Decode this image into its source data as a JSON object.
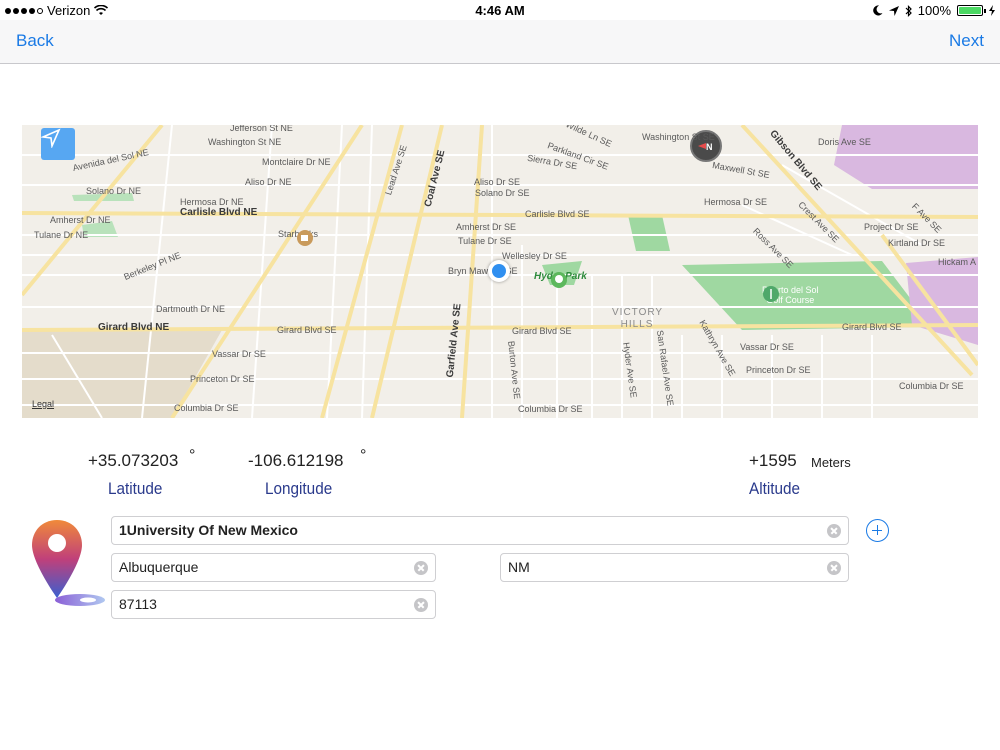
{
  "status_bar": {
    "carrier": "Verizon",
    "time": "4:46 AM",
    "battery": "100%",
    "signal_bars": 4,
    "battery_level": 1.0
  },
  "nav": {
    "back_label": "Back",
    "next_label": "Next"
  },
  "map": {
    "legal": "Legal",
    "streets": {
      "jefferson": "Jefferson St NE",
      "washington_ne": "Washington St NE",
      "avenida": "Avenida del Sol NE",
      "montclaire": "Montclaire Dr NE",
      "aliso_ne": "Aliso Dr NE",
      "solano_ne": "Solano Dr NE",
      "hermosa_ne": "Hermosa Dr NE",
      "carlisle_ne": "Carlisle Blvd NE",
      "amherst_ne": "Amherst Dr NE",
      "tulane_ne": "Tulane Dr NE",
      "berkeley": "Berkeley Pl NE",
      "dartmouth": "Dartmouth Dr NE",
      "girard_ne": "Girard Blvd NE",
      "girard_se_1": "Girard Blvd SE",
      "girard_se_2": "Girard Blvd SE",
      "girard_se_3": "Girard Blvd SE",
      "vassar_se_1": "Vassar Dr SE",
      "vassar_se_2": "Vassar Dr SE",
      "princeton_se_1": "Princeton Dr SE",
      "princeton_se_2": "Princeton Dr SE",
      "columbia_se_1": "Columbia Dr SE",
      "columbia_se_2": "Columbia Dr SE",
      "columbia_se_3": "Columbia Dr SE",
      "lead": "Lead Ave SE",
      "coal": "Coal Ave SE",
      "aliso_se": "Aliso Dr SE",
      "solano_se": "Solano Dr SE",
      "sierra": "Sierra Dr SE",
      "parkland": "Parkland Cir SE",
      "wilde": "Wilde Ln SE",
      "carlisle_se": "Carlisle Blvd SE",
      "amherst_se": "Amherst Dr SE",
      "tulane_se": "Tulane Dr SE",
      "wellesley": "Wellesley Dr SE",
      "bryn_mawr": "Bryn Mawr Dr SE",
      "garfield": "Garfield Ave SE",
      "burton": "Burton Ave SE",
      "hyder_ave": "Hyder Ave SE",
      "san_rafael": "San Rafael Ave SE",
      "kathryn": "Kathryn Ave SE",
      "washington_se": "Washington St SE",
      "maxwell": "Maxwell St SE",
      "gibson": "Gibson Blvd SE",
      "hermosa_se": "Hermosa Dr SE",
      "crest": "Crest Ave SE",
      "ross": "Ross Ave SE",
      "doris": "Doris Ave SE",
      "project": "Project Dr SE",
      "kirtland": "Kirtland Dr SE",
      "f_ave": "F Ave SE",
      "hickam": "Hickam A"
    },
    "pois": {
      "starbucks": "Starbucks",
      "hyder_park": "Hyder Park",
      "victory_hills": "VICTORY HILLS",
      "golf_course_line1": "Puerto del Sol",
      "golf_course_line2": "Golf Course"
    }
  },
  "coordinates": {
    "latitude_value": "+35.073203",
    "latitude_unit": "°",
    "latitude_label": "Latitude",
    "longitude_value": "-106.612198",
    "longitude_unit": "°",
    "longitude_label": "Longitude",
    "altitude_value": "+1595",
    "altitude_unit": "Meters",
    "altitude_label": "Altitude"
  },
  "address": {
    "street": "1University Of New Mexico",
    "city": "Albuquerque",
    "state": "NM",
    "zip": "87113"
  },
  "colors": {
    "accent": "#1a7ae5",
    "label_blue": "#2a3a8c",
    "park_green": "#9fd8a1",
    "map_bg": "#f2efe9",
    "user_dot": "#2f8ff0"
  }
}
